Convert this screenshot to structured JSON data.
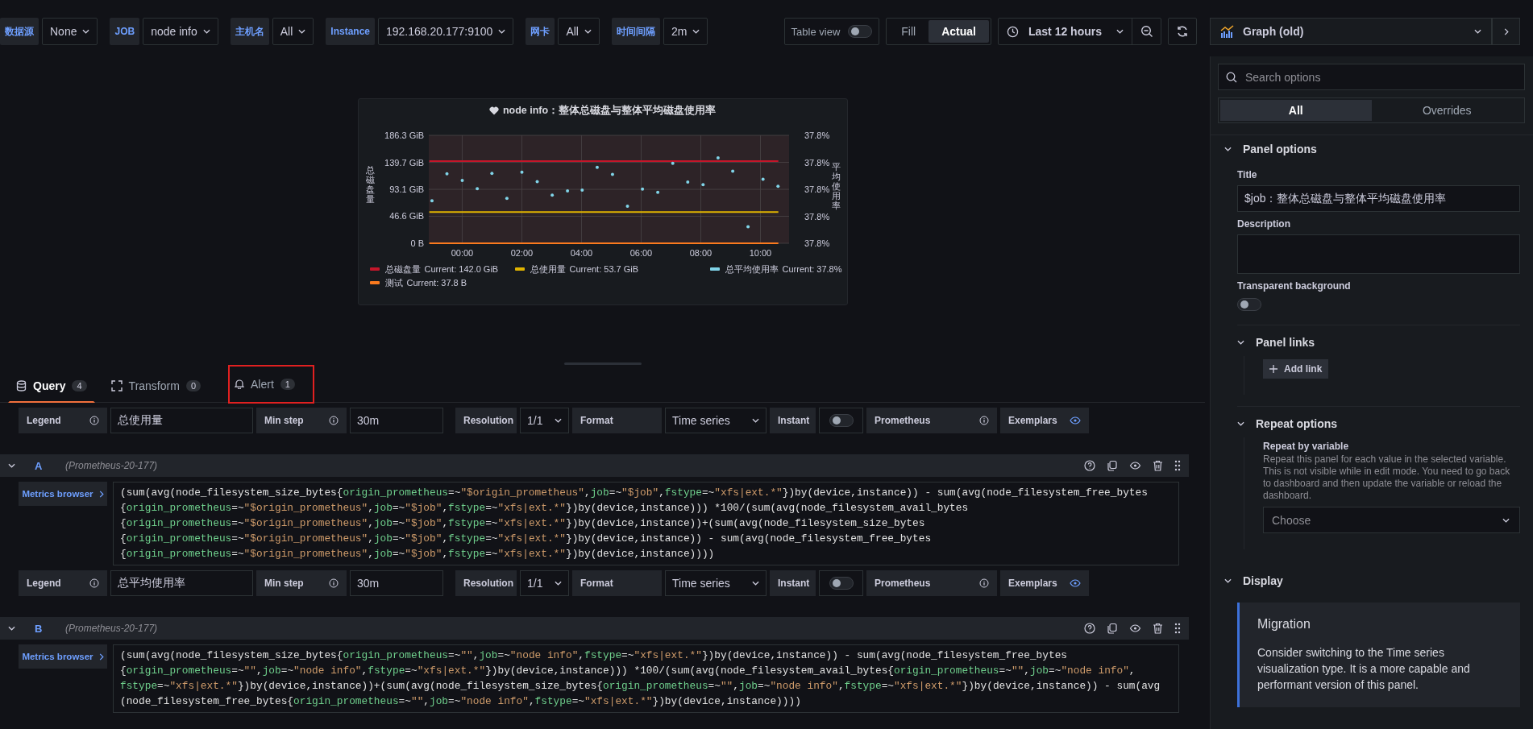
{
  "variables": [
    {
      "label": "数据源",
      "value": "None"
    },
    {
      "label": "JOB",
      "value": "node info"
    },
    {
      "label": "主机名",
      "value": "All"
    },
    {
      "label": "Instance",
      "value": "192.168.20.177:9100"
    },
    {
      "label": "网卡",
      "value": "All"
    },
    {
      "label": "时间间隔",
      "value": "2m"
    }
  ],
  "table_view": {
    "label": "Table view",
    "on": false
  },
  "fill_modes": [
    {
      "label": "Fill",
      "selected": false
    },
    {
      "label": "Actual",
      "selected": true
    }
  ],
  "time_range": "Last 12 hours",
  "visualization": "Graph (old)",
  "panel": {
    "title": "node info：整体总磁盘与整体平均磁盘使用率",
    "y2_label": "平均使用率",
    "right_ticks": [
      "37.8%",
      "37.8%",
      "37.8%",
      "37.8%",
      "37.8%"
    ],
    "chart_data": {
      "type": "line",
      "grid": true,
      "ylabel": "总磁盘量",
      "x": [
        -1.1,
        10.6
      ],
      "xlim": [
        -1.12,
        10.96
      ],
      "ylim": [
        0,
        186.3
      ],
      "xticks": [
        {
          "value": 0,
          "label": "00:00"
        },
        {
          "value": 2,
          "label": "02:00"
        },
        {
          "value": 4,
          "label": "04:00"
        },
        {
          "value": 6,
          "label": "06:00"
        },
        {
          "value": 8,
          "label": "08:00"
        },
        {
          "value": 10,
          "label": "10:00"
        }
      ],
      "yticks": [
        {
          "value": 0,
          "label": "0 B"
        },
        {
          "value": 46.6,
          "label": "46.6 GiB"
        },
        {
          "value": 93.1,
          "label": "93.1 GiB"
        },
        {
          "value": 139.7,
          "label": "139.7 GiB"
        },
        {
          "value": 186.3,
          "label": "186.3 GiB"
        }
      ],
      "series": [
        {
          "name": "总磁盘量",
          "color": "#c4162a",
          "values": [
            142,
            142
          ]
        },
        {
          "name": "总使用量",
          "color": "#e0b400",
          "values": [
            54,
            54
          ]
        },
        {
          "name": "测试",
          "color": "#fa7a1e",
          "values": [
            0,
            0
          ]
        }
      ]
    },
    "points_legend": {
      "name": "总平均使用率",
      "color": "#80d4e8"
    },
    "legend_values": [
      "Current: 142.0 GiB",
      "Current: 53.7 GiB",
      "Current: 37.8%",
      "Current: 37.8 B"
    ]
  },
  "editor_tabs": [
    {
      "label": "Query",
      "count": "4",
      "selected": true,
      "kind": "query",
      "annotated": false
    },
    {
      "label": "Transform",
      "count": "0",
      "selected": false,
      "kind": "transform",
      "annotated": false
    },
    {
      "label": "Alert",
      "count": "1",
      "selected": false,
      "kind": "alert",
      "annotated": true
    }
  ],
  "blocks": [
    {
      "kind": "options",
      "legend_label": "Legend",
      "legend": "总使用量",
      "min_step_label": "Min step",
      "min_step": "30m",
      "resolution_label": "Resolution",
      "resolution": "1/1",
      "format_label": "Format",
      "format": "Time series",
      "instant_label": "Instant",
      "instant": false,
      "datasource_label": "Prometheus",
      "exemplars_label": "Exemplars"
    },
    {
      "kind": "query",
      "letter": "A",
      "datasource": "(Prometheus-20-177)",
      "browser_label": "Metrics browser",
      "code": [
        "(sum(avg(node_filesystem_size_bytes{origin_prometheus=~\"$origin_prometheus\",job=~\"$job\",fstype=~\"xfs|ext.*\"})by(device,instance)) - sum(avg(node_filesystem_free_bytes",
        "{origin_prometheus=~\"$origin_prometheus\",job=~\"$job\",fstype=~\"xfs|ext.*\"})by(device,instance))) *100/(sum(avg(node_filesystem_avail_bytes",
        "{origin_prometheus=~\"$origin_prometheus\",job=~\"$job\",fstype=~\"xfs|ext.*\"})by(device,instance))+(sum(avg(node_filesystem_size_bytes",
        "{origin_prometheus=~\"$origin_prometheus\",job=~\"$job\",fstype=~\"xfs|ext.*\"})by(device,instance)) - sum(avg(node_filesystem_free_bytes",
        "{origin_prometheus=~\"$origin_prometheus\",job=~\"$job\",fstype=~\"xfs|ext.*\"})by(device,instance))))"
      ]
    },
    {
      "kind": "options",
      "legend_label": "Legend",
      "legend": "总平均使用率",
      "min_step_label": "Min step",
      "min_step": "30m",
      "resolution_label": "Resolution",
      "resolution": "1/1",
      "format_label": "Format",
      "format": "Time series",
      "instant_label": "Instant",
      "instant": false,
      "datasource_label": "Prometheus",
      "exemplars_label": "Exemplars"
    },
    {
      "kind": "query",
      "letter": "B",
      "datasource": "(Prometheus-20-177)",
      "browser_label": "Metrics browser",
      "code": [
        "(sum(avg(node_filesystem_size_bytes{origin_prometheus=~\"\",job=~\"node info\",fstype=~\"xfs|ext.*\"})by(device,instance)) - sum(avg(node_filesystem_free_bytes",
        "{origin_prometheus=~\"\",job=~\"node info\",fstype=~\"xfs|ext.*\"})by(device,instance))) *100/(sum(avg(node_filesystem_avail_bytes{origin_prometheus=~\"\",job=~\"node info\",",
        "fstype=~\"xfs|ext.*\"})by(device,instance))+(sum(avg(node_filesystem_size_bytes{origin_prometheus=~\"\",job=~\"node info\",fstype=~\"xfs|ext.*\"})by(device,instance)) - sum(avg",
        "(node_filesystem_free_bytes{origin_prometheus=~\"\",job=~\"node info\",fstype=~\"xfs|ext.*\"})by(device,instance))))"
      ]
    }
  ],
  "options_pane": {
    "search_placeholder": "Search options",
    "tabs": [
      {
        "label": "All",
        "selected": true
      },
      {
        "label": "Overrides",
        "selected": false
      }
    ],
    "panel_options": {
      "heading": "Panel options",
      "title_label": "Title",
      "title_value": "$job：整体总磁盘与整体平均磁盘使用率",
      "description_label": "Description",
      "transparent_label": "Transparent background",
      "transparent": false
    },
    "panel_links": {
      "heading": "Panel links",
      "add_label": "Add link"
    },
    "repeat": {
      "heading": "Repeat options",
      "label": "Repeat by variable",
      "help": "Repeat this panel for each value in the selected variable. This is not visible while in edit mode. You need to go back to dashboard and then update the variable or reload the dashboard.",
      "placeholder": "Choose"
    },
    "display": {
      "heading": "Display",
      "migration_title": "Migration",
      "migration_text": "Consider switching to the Time series visualization type. It is a more capable and performant version of this panel."
    }
  }
}
